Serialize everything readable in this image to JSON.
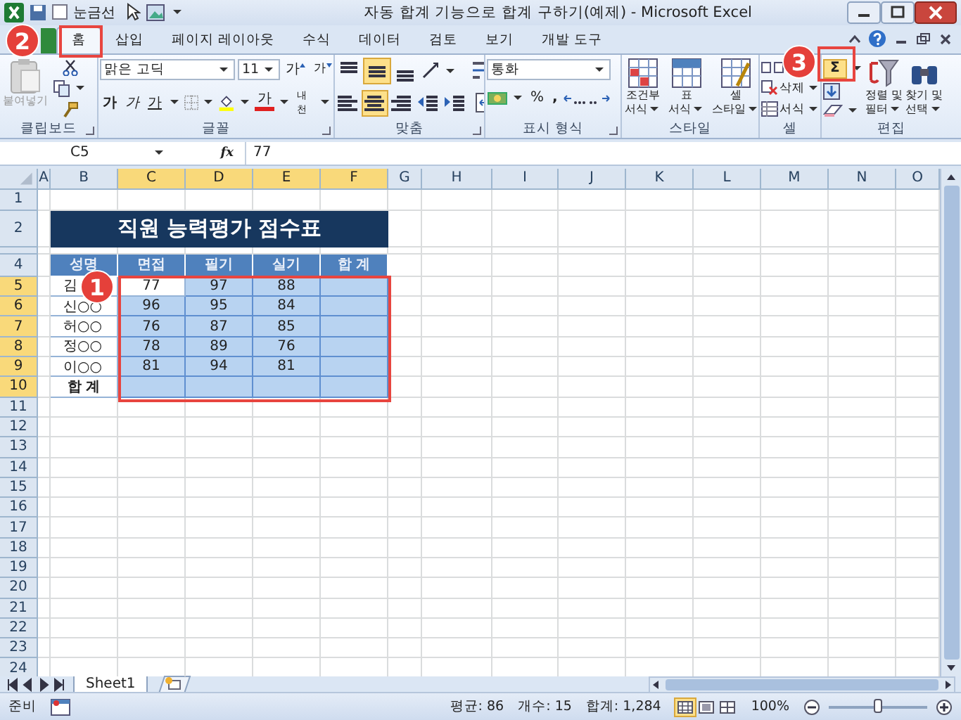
{
  "window": {
    "title": "자동 합계 기능으로 합계 구하기(예제) - Microsoft Excel"
  },
  "quick_access": {
    "gridlines": {
      "label": "눈금선",
      "checked": false
    }
  },
  "tabs": [
    {
      "label": "홈",
      "selected": true
    },
    {
      "label": "삽입",
      "selected": false
    },
    {
      "label": "페이지 레이아웃",
      "selected": false
    },
    {
      "label": "수식",
      "selected": false
    },
    {
      "label": "데이터",
      "selected": false
    },
    {
      "label": "검토",
      "selected": false
    },
    {
      "label": "보기",
      "selected": false
    },
    {
      "label": "개발 도구",
      "selected": false
    }
  ],
  "ribbon": {
    "clipboard": {
      "label": "클립보드",
      "paste": "붙여넣기",
      "paste_disabled": true
    },
    "font": {
      "label": "글꼴",
      "name": "맑은 고딕",
      "size": "11",
      "grow": "가",
      "shrink": "가",
      "bold": "가",
      "italic": "가",
      "underline": "가",
      "font_color_label": "가",
      "phonetic": "내천"
    },
    "alignment": {
      "label": "맞춤",
      "top_row": [
        {
          "kind": "top",
          "selected": false
        },
        {
          "kind": "middle",
          "selected": true
        },
        {
          "kind": "bottom",
          "selected": false
        }
      ],
      "bottom_row": [
        {
          "kind": "left",
          "selected": false
        },
        {
          "kind": "center",
          "selected": true
        },
        {
          "kind": "right",
          "selected": false
        },
        {
          "kind": "outdent",
          "selected": false
        },
        {
          "kind": "indent",
          "selected": false
        }
      ]
    },
    "number": {
      "label": "표시 형식",
      "format": "통화",
      "percent": "%",
      "comma": ","
    },
    "styles": {
      "label": "스타일",
      "buttons": [
        {
          "lines": [
            "조건부",
            "서식"
          ]
        },
        {
          "lines": [
            "표",
            "서식"
          ]
        },
        {
          "lines": [
            "셀",
            "스타일"
          ]
        }
      ]
    },
    "cells": {
      "label": "셀",
      "delete": "삭제",
      "format": "서식"
    },
    "editing": {
      "label": "편집",
      "autosum": "Σ",
      "autosum_selected": true,
      "buttons": [
        {
          "lines": [
            "정렬 및",
            "필터"
          ]
        },
        {
          "lines": [
            "찾기 및",
            "선택"
          ]
        }
      ]
    }
  },
  "formula_bar": {
    "name_box": "C5",
    "fx": "fx",
    "value": "77"
  },
  "sheet": {
    "title": "직원 능력평가 점수표",
    "columns": [
      {
        "label": "A",
        "selected": false
      },
      {
        "label": "B",
        "selected": false
      },
      {
        "label": "C",
        "selected": true
      },
      {
        "label": "D",
        "selected": true
      },
      {
        "label": "E",
        "selected": true
      },
      {
        "label": "F",
        "selected": true
      },
      {
        "label": "G",
        "selected": false
      },
      {
        "label": "H",
        "selected": false
      },
      {
        "label": "I",
        "selected": false
      },
      {
        "label": "J",
        "selected": false
      },
      {
        "label": "K",
        "selected": false
      },
      {
        "label": "L",
        "selected": false
      },
      {
        "label": "M",
        "selected": false
      },
      {
        "label": "N",
        "selected": false
      },
      {
        "label": "O",
        "selected": false
      }
    ],
    "rows": [
      {
        "label": "1",
        "selected": false
      },
      {
        "label": "2",
        "selected": false
      },
      {
        "selected": false
      },
      {
        "label": "4",
        "selected": false
      },
      {
        "label": "5",
        "selected": true
      },
      {
        "label": "6",
        "selected": true
      },
      {
        "label": "7",
        "selected": true
      },
      {
        "label": "8",
        "selected": true
      },
      {
        "label": "9",
        "selected": true
      },
      {
        "label": "10",
        "selected": true
      },
      {
        "label": "11",
        "selected": false
      },
      {
        "label": "12",
        "selected": false
      },
      {
        "label": "13",
        "selected": false
      },
      {
        "label": "14",
        "selected": false
      },
      {
        "label": "15",
        "selected": false
      },
      {
        "label": "16",
        "selected": false
      },
      {
        "label": "17",
        "selected": false
      },
      {
        "label": "18",
        "selected": false
      },
      {
        "label": "19",
        "selected": false
      },
      {
        "label": "20",
        "selected": false
      },
      {
        "label": "21",
        "selected": false
      },
      {
        "label": "22",
        "selected": false
      },
      {
        "label": "23",
        "selected": false
      },
      {
        "label": "24",
        "selected": false
      }
    ],
    "table": {
      "header": [
        "성명",
        "면접",
        "필기",
        "실기",
        "합 계"
      ],
      "rows": [
        {
          "name": "김",
          "values": [
            "77",
            "97",
            "88"
          ]
        },
        {
          "name": "신○○",
          "values": [
            "96",
            "95",
            "84"
          ]
        },
        {
          "name": "허○○",
          "values": [
            "76",
            "87",
            "85"
          ]
        },
        {
          "name": "정○○",
          "values": [
            "78",
            "89",
            "76"
          ]
        },
        {
          "name": "이○○",
          "values": [
            "81",
            "94",
            "81"
          ]
        }
      ],
      "total_label": "합 계"
    }
  },
  "sheet_tabs": [
    {
      "label": "Sheet1",
      "selected": true
    }
  ],
  "status_bar": {
    "mode": "준비",
    "average": "평균: 86",
    "count": "개수: 15",
    "sum": "합계: 1,284",
    "views": [
      {
        "kind": "normal",
        "selected": true
      },
      {
        "kind": "layout",
        "selected": false
      },
      {
        "kind": "preview",
        "selected": false
      }
    ],
    "zoom": "100%",
    "zoom_slider": {
      "level": 0.5
    }
  },
  "annotations": [
    {
      "label": "1"
    },
    {
      "label": "2"
    },
    {
      "label": "3"
    }
  ]
}
